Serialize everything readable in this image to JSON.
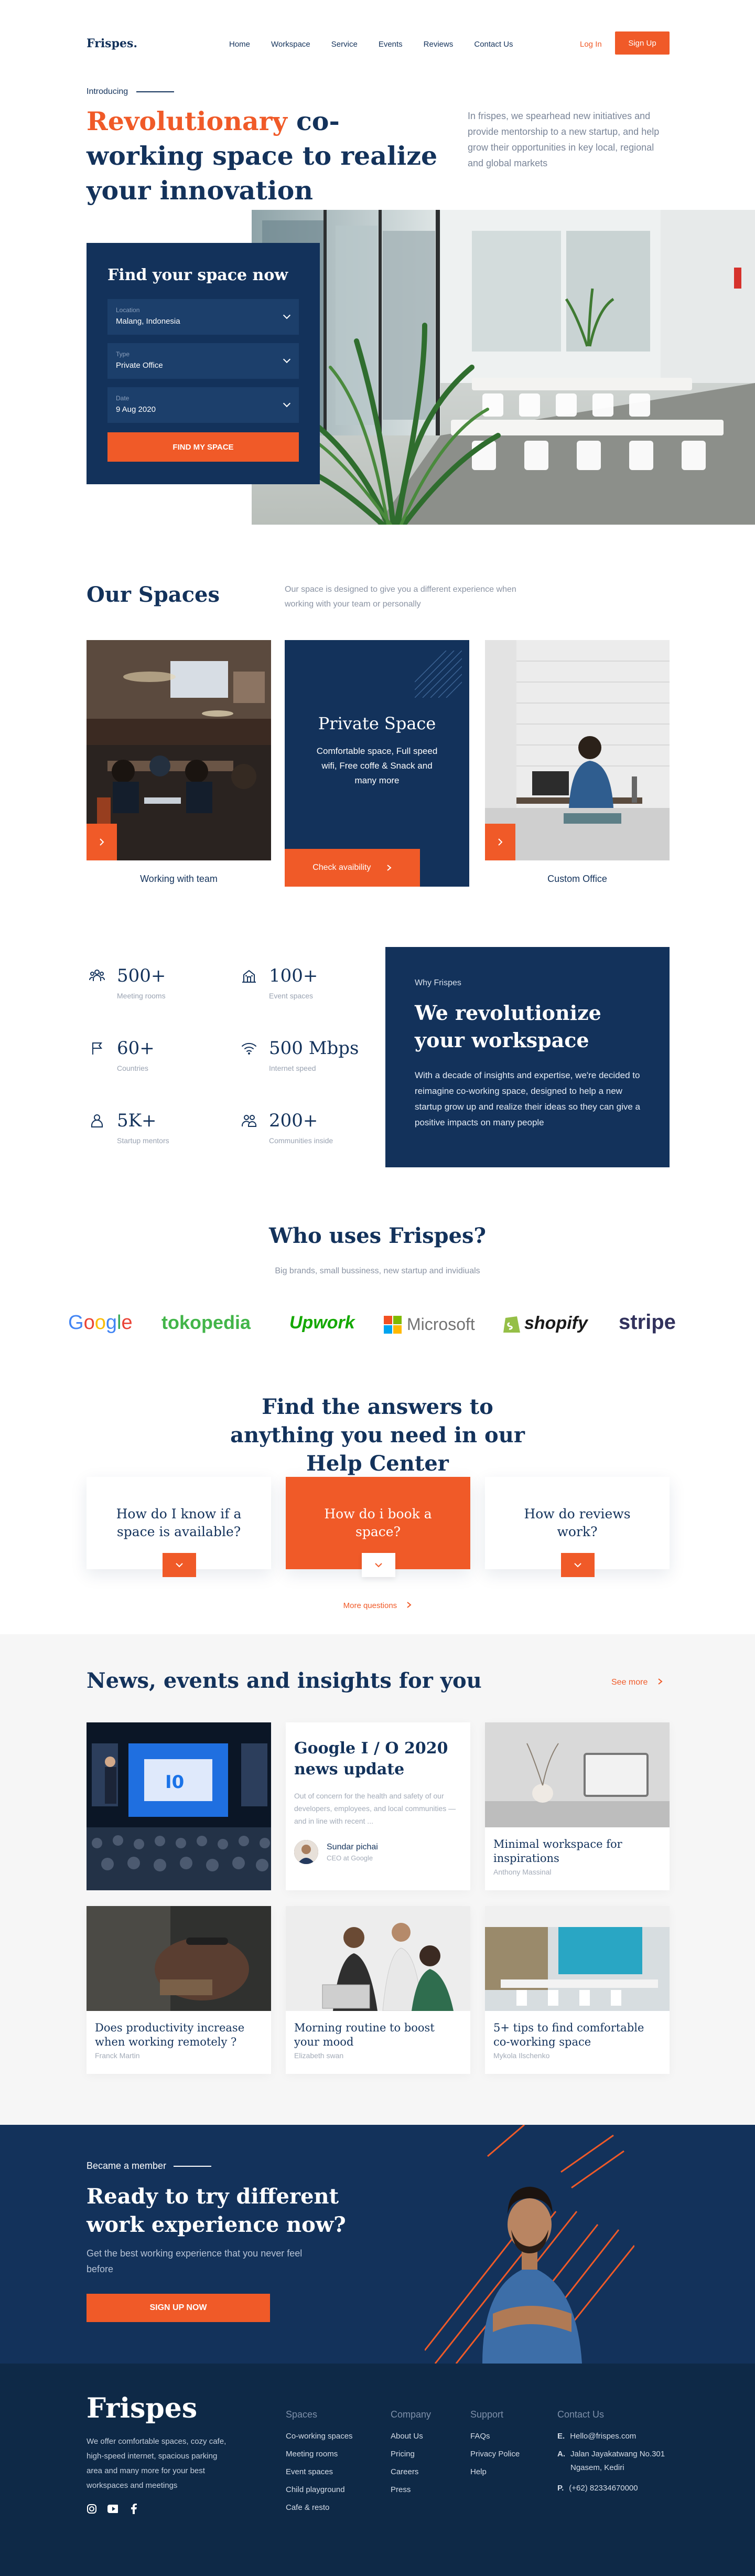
{
  "nav": {
    "logo": "Frispes.",
    "items": [
      "Home",
      "Workspace",
      "Service",
      "Events",
      "Reviews",
      "Contact Us"
    ],
    "login": "Log In",
    "signup": "Sign Up"
  },
  "hero": {
    "intro": "Introducing",
    "title_accent": "Revolutionary",
    "title_rest": "co-working space to realize your innovation",
    "description": "In frispes, we spearhead new initiatives and provide mentorship to a new startup, and help grow their opportunities in key local, regional and global markets"
  },
  "finder": {
    "title": "Find your space now",
    "fields": [
      {
        "label": "Location",
        "value": "Malang, Indonesia"
      },
      {
        "label": "Type",
        "value": "Private Office"
      },
      {
        "label": "Date",
        "value": "9 Aug 2020"
      }
    ],
    "button": "FIND MY SPACE"
  },
  "spaces": {
    "title": "Our Spaces",
    "description": "Our space is designed to give you a different experience when working with your team or personally",
    "card1_caption": "Working with team",
    "private_title": "Private Space",
    "private_text": "Comfortable space, Full speed wifi, Free coffe & Snack and many more",
    "private_button": "Check avaibility",
    "card3_caption": "Custom Office"
  },
  "stats": [
    {
      "num": "500+",
      "label": "Meeting rooms",
      "icon": "people-group-icon"
    },
    {
      "num": "100+",
      "label": "Event spaces",
      "icon": "building-icon"
    },
    {
      "num": "60+",
      "label": "Countries",
      "icon": "flag-icon"
    },
    {
      "num": "500 Mbps",
      "label": "Internet speed",
      "icon": "wifi-icon"
    },
    {
      "num": "5K+",
      "label": "Startup mentors",
      "icon": "user-icon"
    },
    {
      "num": "200+",
      "label": "Communities inside",
      "icon": "community-icon"
    }
  ],
  "why": {
    "small": "Why Frispes",
    "title": "We revolutionize your workspace",
    "text": "With a decade of insights and expertise, we're decided to reimagine co-working space, designed to help a new startup grow up and realize their ideas so they can give a positive impacts on many people"
  },
  "who": {
    "title": "Who uses Frispes?",
    "subtitle": "Big brands, small bussiness, new startup and invidiuals",
    "brands": [
      "Google",
      "tokopedia",
      "Upwork",
      "Microsoft",
      "shopify",
      "stripe"
    ]
  },
  "help": {
    "title": "Find the answers to anything you need in our Help Center",
    "questions": [
      "How do I know if a space is available?",
      "How do i book a space?",
      "How do reviews work?"
    ],
    "more": "More questions"
  },
  "news": {
    "title": "News, events and insights for you",
    "see_more": "See more",
    "featured": {
      "title": "Google I / O 2020 news update",
      "excerpt": "Out of concern for the health and safety of our developers, employees, and local communities — and in line with recent ...",
      "author": "Sundar pichai",
      "role": "CEO at Google"
    },
    "cards": [
      {
        "title": "Minimal workspace for inspirations",
        "author": "Anthony Massinal"
      },
      {
        "title": "Does productivity increase when working remotely ?",
        "author": "Franck Martin"
      },
      {
        "title": "Morning routine to boost your mood",
        "author": "Elizabeth swan"
      },
      {
        "title": "5+ tips to find comfortable co-working space",
        "author": "Mykola Ilschenko"
      }
    ]
  },
  "cta": {
    "small": "Became a member",
    "title": "Ready to try different work experience now?",
    "description": "Get the best working experience that you never feel before",
    "button": "SIGN UP NOW"
  },
  "footer": {
    "logo": "Frispes",
    "description": "We offer comfortable spaces, cozy cafe, high-speed internet, spacious parking area and many more for your best workspaces and meetings",
    "spaces": {
      "heading": "Spaces",
      "items": [
        "Co-working spaces",
        "Meeting rooms",
        "Event spaces",
        "Child playground",
        "Cafe & resto"
      ]
    },
    "company": {
      "heading": "Company",
      "items": [
        "About Us",
        "Pricing",
        "Careers",
        "Press"
      ]
    },
    "support": {
      "heading": "Support",
      "items": [
        "FAQs",
        "Privacy Police",
        "Help"
      ]
    },
    "contact": {
      "heading": "Contact Us",
      "email_label": "E.",
      "email": "Hello@frispes.com",
      "address_label": "A.",
      "address": "Jalan Jayakatwang  No.301 Ngasem, Kediri",
      "phone_label": "P.",
      "phone": "(+62) 82334670000"
    }
  },
  "colors": {
    "navy": "#13325b",
    "accent": "#f05a28"
  }
}
